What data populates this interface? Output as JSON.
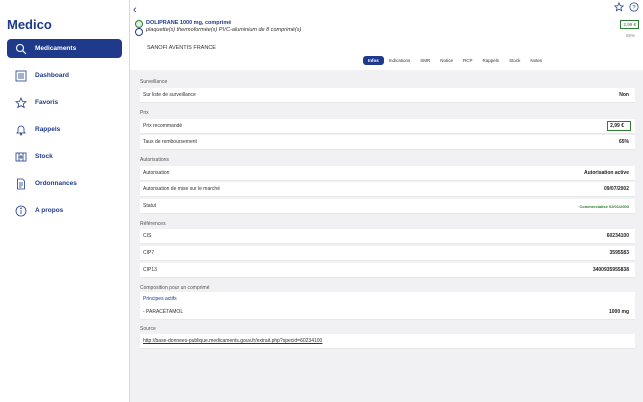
{
  "app": {
    "title": "Medico"
  },
  "sidebar": {
    "items": [
      {
        "label": "Medicaments",
        "icon": "search-icon"
      },
      {
        "label": "Dashboard",
        "icon": "list-icon"
      },
      {
        "label": "Favoris",
        "icon": "star-icon"
      },
      {
        "label": "Rappels",
        "icon": "bell-icon"
      },
      {
        "label": "Stock",
        "icon": "stock-icon"
      },
      {
        "label": "Ordonnances",
        "icon": "prescription-icon"
      },
      {
        "label": "A propos",
        "icon": "info-icon"
      }
    ]
  },
  "drug": {
    "title": "DOLIPRANE 1000 mg, comprimé",
    "subtitle": "plaquette(s) thermoformée(s) PVC-aluminium de 8 comprimé(s)",
    "lab": "SANOFI AVENTIS FRANCE",
    "price_badge": "2,99 €",
    "rate": "65%"
  },
  "tabs": [
    "Infos",
    "Indications",
    "SMR",
    "Notice",
    "RCP",
    "Rappels",
    "Stock",
    "Notes"
  ],
  "sections": {
    "surveillance": {
      "title": "Surveillance",
      "label": "Sur liste de surveillance",
      "value": "Non"
    },
    "prix": {
      "title": "Prix",
      "prix_label": "Prix recommandé",
      "prix_value": "2,99 €",
      "taux_label": "Taux de remboursement",
      "taux_value": "65%"
    },
    "autorisations": {
      "title": "Autorisations",
      "autorisation_label": "Autorisation",
      "autorisation_value": "Autorisation active",
      "date_label": "Autorisation de mise sur le marché",
      "date_value": "09/07/2002",
      "statut_label": "Statut",
      "statut_value": "Commercialisé 02/01/2003"
    },
    "references": {
      "title": "Références",
      "cis_label": "CIS",
      "cis_value": "60234100",
      "cip7_label": "CIP7",
      "cip7_value": "3595583",
      "cip13_label": "CIP13",
      "cip13_value": "3400935955838"
    },
    "composition": {
      "title": "Composition pour un comprimé",
      "subtitle": "Principes actifs",
      "item_label": "- PARACÉTAMOL",
      "item_value": "1000 mg"
    },
    "source": {
      "title": "Source",
      "url": "http://base-donnees-publique.medicaments.gouv.fr/extrait.php?specid=60234100"
    }
  },
  "colors": {
    "accent": "#1f3a8a",
    "success": "#2e7d32"
  }
}
